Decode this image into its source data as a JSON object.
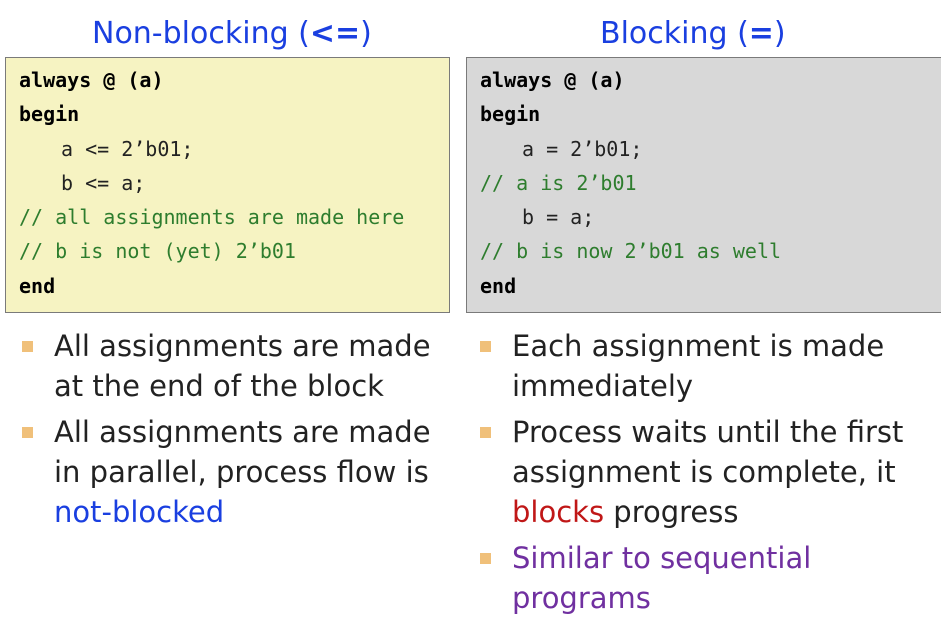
{
  "left": {
    "title_text": "Non-blocking (",
    "title_op": "<=",
    "title_close": ")",
    "code": [
      "always @ (a)",
      "begin",
      "a <= 2’b01;",
      "b <= a;",
      "// all assignments are made here",
      "// b is not (yet) 2’b01",
      "end"
    ],
    "bullets": [
      {
        "text": "All assignments are made at the end of the block"
      },
      {
        "text_before": "All assignments are made in parallel, process flow is ",
        "highlight": "not-blocked"
      }
    ]
  },
  "right": {
    "title_text": "Blocking (",
    "title_op": "=",
    "title_close": ")",
    "code": [
      "always @ (a)",
      "begin",
      "a = 2’b01;",
      "// a is 2’b01",
      "b = a;",
      "// b is now 2’b01 as well",
      "end"
    ],
    "bullets": [
      {
        "text": "Each assignment is made immediately"
      },
      {
        "text_before": "Process waits until the first assignment is complete, it ",
        "highlight": "blocks",
        "text_after": " progress"
      },
      {
        "text": "Similar to sequential programs"
      }
    ]
  },
  "colors": {
    "title_blue": "#1a3fe0",
    "comment_green": "#2e7d2e",
    "nonblocking_bg": "#f6f3c2",
    "blocking_bg": "#d8d8d8",
    "highlight_red": "#c01717",
    "highlight_purple": "#7030a0",
    "bullet_square": "#f0c07a"
  }
}
